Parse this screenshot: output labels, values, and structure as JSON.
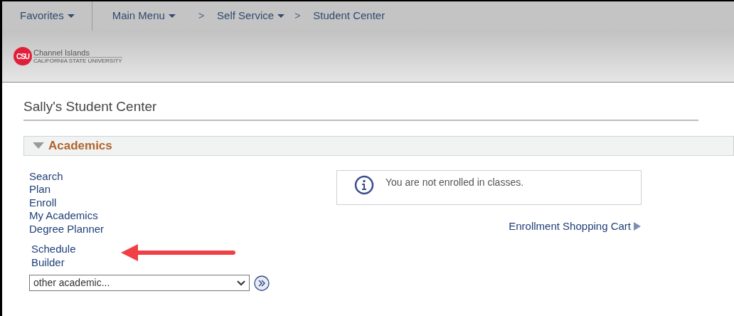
{
  "nav": {
    "items": [
      {
        "label": "Favorites",
        "dropdown": true,
        "kind": "favorites"
      },
      {
        "label": "Main Menu",
        "dropdown": true,
        "kind": "menu"
      },
      {
        "label": "Self Service",
        "dropdown": true,
        "kind": "crumb",
        "prefix": ">"
      },
      {
        "label": "Student Center",
        "dropdown": false,
        "kind": "crumb",
        "prefix": ">"
      }
    ]
  },
  "logo": {
    "mark": "CSU",
    "name": "Channel Islands",
    "subtitle": "CALIFORNIA STATE UNIVERSITY"
  },
  "page_title": "Sally's Student Center",
  "section": {
    "title": "Academics",
    "expanded": true,
    "links": [
      {
        "label": "Search"
      },
      {
        "label": "Plan"
      },
      {
        "label": "Enroll"
      },
      {
        "label": "My Academics"
      },
      {
        "label": "Degree Planner"
      }
    ],
    "schedule_builder": [
      "Schedule",
      "Builder"
    ],
    "select": {
      "value": "other academic..."
    },
    "message": "You are not enrolled in classes.",
    "cart_link": "Enrollment Shopping Cart"
  }
}
